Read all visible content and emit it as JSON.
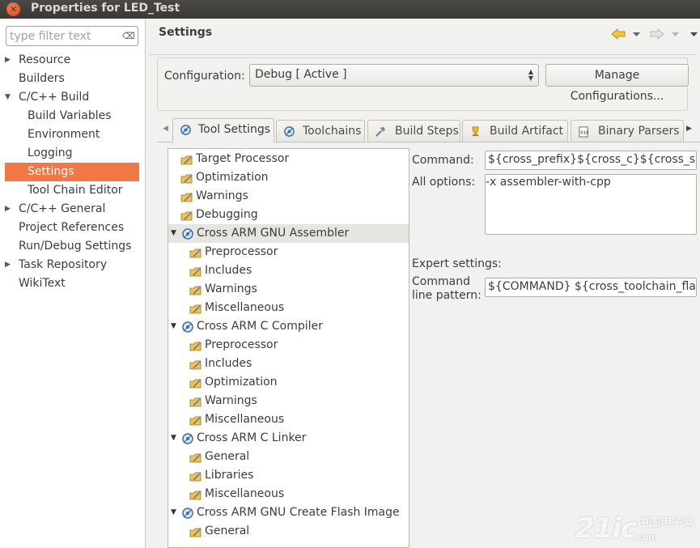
{
  "window": {
    "title": "Properties for LED_Test",
    "close_glyph": "✕"
  },
  "filter": {
    "placeholder": "type filter text",
    "clear_glyph": "⌫"
  },
  "left_tree": [
    {
      "label": "Resource",
      "expander": "▶",
      "level": 0
    },
    {
      "label": "Builders",
      "expander": "",
      "level": 0
    },
    {
      "label": "C/C++ Build",
      "expander": "▼",
      "level": 0
    },
    {
      "label": "Build Variables",
      "expander": "",
      "level": 1
    },
    {
      "label": "Environment",
      "expander": "",
      "level": 1
    },
    {
      "label": "Logging",
      "expander": "",
      "level": 1
    },
    {
      "label": "Settings",
      "expander": "",
      "level": 1,
      "selected": true
    },
    {
      "label": "Tool Chain Editor",
      "expander": "",
      "level": 1
    },
    {
      "label": "C/C++ General",
      "expander": "▶",
      "level": 0
    },
    {
      "label": "Project References",
      "expander": "",
      "level": 0
    },
    {
      "label": "Run/Debug Settings",
      "expander": "",
      "level": 0
    },
    {
      "label": "Task Repository",
      "expander": "▶",
      "level": 0
    },
    {
      "label": "WikiText",
      "expander": "",
      "level": 0
    }
  ],
  "header": {
    "title": "Settings",
    "back_icon": "arrow-left-icon",
    "forward_icon": "arrow-right-icon",
    "menu_icon": "chevron-down-icon"
  },
  "configuration": {
    "label": "Configuration:",
    "value": "Debug  [ Active ]",
    "manage_button": "Manage Configurations..."
  },
  "tabs": [
    {
      "label": "Tool Settings",
      "active": true,
      "icon": "gear-icon"
    },
    {
      "label": "Toolchains",
      "active": false,
      "icon": "gear-icon"
    },
    {
      "label": "Build Steps",
      "active": false,
      "icon": "hammer-icon"
    },
    {
      "label": "Build Artifact",
      "active": false,
      "icon": "trophy-icon"
    },
    {
      "label": "Binary Parsers",
      "active": false,
      "icon": "binary-icon"
    }
  ],
  "tool_tree": [
    {
      "label": "Target Processor",
      "kind": "option",
      "level": 0
    },
    {
      "label": "Optimization",
      "kind": "option",
      "level": 0
    },
    {
      "label": "Warnings",
      "kind": "option",
      "level": 0
    },
    {
      "label": "Debugging",
      "kind": "option",
      "level": 0
    },
    {
      "label": "Cross ARM GNU Assembler",
      "kind": "tool",
      "level": 0,
      "selected": true
    },
    {
      "label": "Preprocessor",
      "kind": "option",
      "level": 1
    },
    {
      "label": "Includes",
      "kind": "option",
      "level": 1
    },
    {
      "label": "Warnings",
      "kind": "option",
      "level": 1
    },
    {
      "label": "Miscellaneous",
      "kind": "option",
      "level": 1
    },
    {
      "label": "Cross ARM C Compiler",
      "kind": "tool",
      "level": 0
    },
    {
      "label": "Preprocessor",
      "kind": "option",
      "level": 1
    },
    {
      "label": "Includes",
      "kind": "option",
      "level": 1
    },
    {
      "label": "Optimization",
      "kind": "option",
      "level": 1
    },
    {
      "label": "Warnings",
      "kind": "option",
      "level": 1
    },
    {
      "label": "Miscellaneous",
      "kind": "option",
      "level": 1
    },
    {
      "label": "Cross ARM C Linker",
      "kind": "tool",
      "level": 0
    },
    {
      "label": "General",
      "kind": "option",
      "level": 1
    },
    {
      "label": "Libraries",
      "kind": "option",
      "level": 1
    },
    {
      "label": "Miscellaneous",
      "kind": "option",
      "level": 1
    },
    {
      "label": "Cross ARM GNU Create Flash Image",
      "kind": "tool",
      "level": 0
    },
    {
      "label": "General",
      "kind": "option",
      "level": 1
    }
  ],
  "settings": {
    "command_label": "Command:",
    "command_value": "${cross_prefix}${cross_c}${cross_suffix}",
    "all_options_label": "All options:",
    "all_options_value": "-x assembler-with-cpp",
    "expert_label": "Expert settings:",
    "pattern_label_1": "Command",
    "pattern_label_2": "line pattern:",
    "pattern_value": "${COMMAND} ${cross_toolchain_flags}"
  },
  "watermark": {
    "main": "21ic",
    "sub": "中国电子网",
    "com": ".com"
  },
  "colors": {
    "selection": "#f07746",
    "titlebar": "#3c3b37",
    "panel": "#f2f1f0"
  }
}
